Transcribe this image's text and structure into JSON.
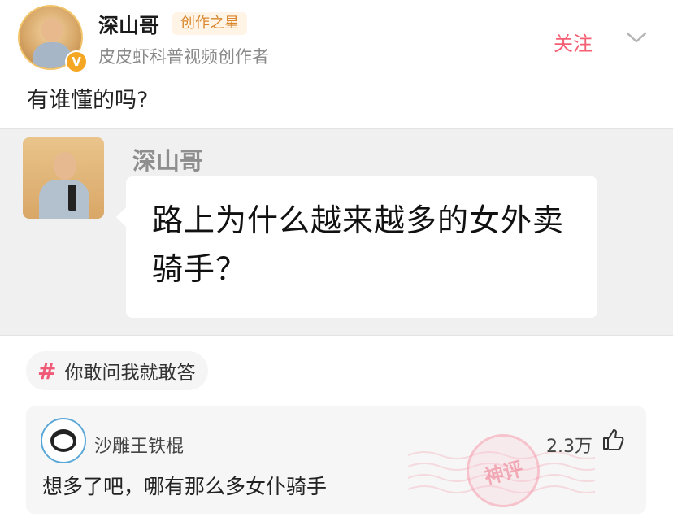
{
  "post": {
    "author": {
      "name": "深山哥",
      "tag": "创作之星",
      "description": "皮皮虾科普视频创作者",
      "verified_badge": "V"
    },
    "follow_label": "关注",
    "text": "有谁懂的吗?"
  },
  "quote": {
    "author_name": "深山哥",
    "text": "路上为什么越来越多的女外卖骑手？"
  },
  "topic": {
    "icon": "#",
    "label": "你敢问我就敢答"
  },
  "comment": {
    "author_name": "沙雕王铁棍",
    "likes": "2.3万",
    "text": "想多了吧，哪有那么多女仆骑手",
    "stamp_text": "神评"
  },
  "colors": {
    "accent": "#f55f74",
    "creator_tag_bg": "#fff4e6",
    "creator_tag_text": "#d9862c",
    "verify_badge": "#f5a623"
  }
}
